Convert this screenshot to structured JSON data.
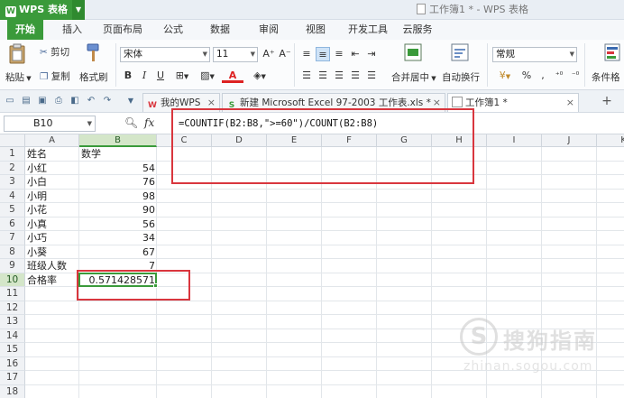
{
  "app": {
    "name": "WPS 表格",
    "window_title": "工作簿1 * - WPS 表格"
  },
  "ribbon_tabs": [
    "开始",
    "插入",
    "页面布局",
    "公式",
    "数据",
    "审阅",
    "视图",
    "开发工具",
    "云服务"
  ],
  "ribbon": {
    "paste": "粘贴",
    "cut": "剪切",
    "copy": "复制",
    "format_painter": "格式刷",
    "font_name": "宋体",
    "font_size": "11",
    "merge_center": "合并居中",
    "wrap_text": "自动换行",
    "number_format": "常规",
    "conditional_format": "条件格",
    "percent": "%",
    "comma": ",",
    "bold": "B",
    "italic": "I",
    "underline": "U",
    "font_grow": "A⁺",
    "font_shrink": "A⁻"
  },
  "doc_tabs": [
    {
      "label": "我的WPS",
      "active": false
    },
    {
      "label": "新建 Microsoft Excel 97-2003 工作表.xls *",
      "active": false
    },
    {
      "label": "工作簿1 *",
      "active": true
    }
  ],
  "formula_bar": {
    "name_box": "B10",
    "fx": "fx",
    "formula": "=COUNTIF(B2:B8,\">=60\")/COUNT(B2:B8)"
  },
  "columns": [
    "A",
    "B",
    "C",
    "D",
    "E",
    "F",
    "G",
    "H",
    "I",
    "J",
    "K"
  ],
  "rows": [
    "1",
    "2",
    "3",
    "4",
    "5",
    "6",
    "7",
    "8",
    "9",
    "10",
    "11",
    "12",
    "13",
    "14",
    "15",
    "16",
    "17",
    "18"
  ],
  "cells": {
    "A1": "姓名",
    "B1": "数学",
    "A2": "小红",
    "B2": "54",
    "A3": "小白",
    "B3": "76",
    "A4": "小明",
    "B4": "98",
    "A5": "小花",
    "B5": "90",
    "A6": "小真",
    "B6": "56",
    "A7": "小巧",
    "B7": "34",
    "A8": "小葵",
    "B8": "67",
    "A9": "班级人数",
    "B9": "7",
    "A10": "合格率",
    "B10": "0.571428571"
  },
  "selected": {
    "column": "B",
    "row": "10"
  },
  "watermark": {
    "text": "搜狗指南",
    "url": "zhinan.sogou.com"
  },
  "colors": {
    "accent": "#3a9a3a",
    "highlight": "#d9363e"
  }
}
